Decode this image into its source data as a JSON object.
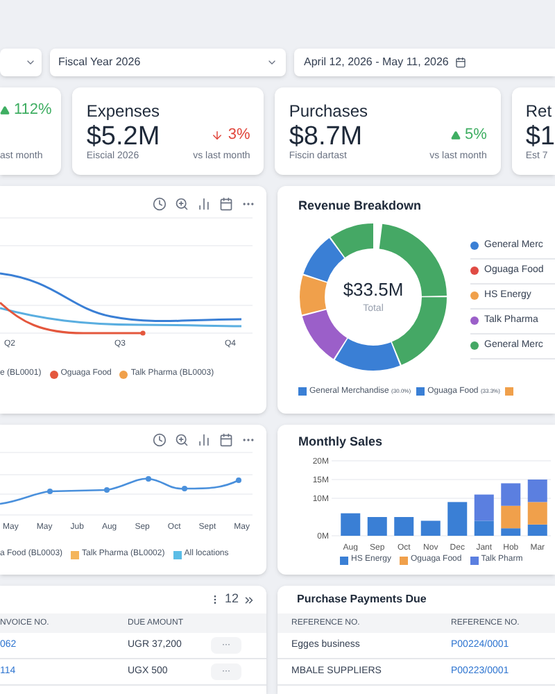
{
  "filters": {
    "fiscal_year": "Fiscal Year 2026",
    "date_range": "April 12, 2026 - May 11, 2026"
  },
  "kpis": [
    {
      "change": "112%",
      "rising": true,
      "note": "ast month"
    },
    {
      "title": "Expenses",
      "value": "$5.2M",
      "change": "3%",
      "rising": false,
      "subtitle": "Eiscial 2026",
      "note": "vs last month"
    },
    {
      "title": "Purchases",
      "value": "$8.7M",
      "change": "5%",
      "rising": true,
      "subtitle": "Fiscin dartast",
      "note": "vs last month"
    },
    {
      "title": "Ret",
      "value": "$1",
      "subtitle": "Est 7"
    }
  ],
  "revenue_by_location": {
    "x_labels": [
      "Q2",
      "Q3",
      "Q4"
    ],
    "legend": [
      {
        "label": "e (BL0001)"
      },
      {
        "label": "Oguaga Food",
        "color": "#e4573d"
      },
      {
        "label": "Talk Pharma (BL0003)",
        "color": "#f0a04b"
      }
    ]
  },
  "revenue_breakdown": {
    "title": "Revenue Breakdown",
    "total": "$33.5M",
    "total_label": "Total",
    "legend": [
      {
        "label": "General Merc",
        "color": "#3a7fd5"
      },
      {
        "label": "Oguaga Food",
        "color": "#e04b44"
      },
      {
        "label": "HS Energy",
        "color": "#f0a04b"
      },
      {
        "label": "Talk Pharma",
        "color": "#9b5fc9"
      },
      {
        "label": "General Merc",
        "color": "#45a865"
      }
    ],
    "bottom_legend": [
      {
        "label": "General Merchandise",
        "share": "(30.0%)",
        "color": "#3a7fd5"
      },
      {
        "label": "Oguaga Food",
        "share": "(33.3%)",
        "color": "#3a7fd5"
      },
      {
        "color": "#f0a04b"
      }
    ]
  },
  "trend_chart": {
    "x_labels": [
      "May",
      "May",
      "Jub",
      "Aug",
      "Sep",
      "Oct",
      "Sept",
      "May"
    ],
    "legend": [
      {
        "label": "a Food (BL0003)"
      },
      {
        "label": "Talk Pharma (BL0002)",
        "color": "#f4b55b"
      },
      {
        "label": "All locations",
        "color": "#5bbde6"
      }
    ]
  },
  "monthly_sales": {
    "title": "Monthly Sales",
    "chart_data": {
      "type": "bar",
      "stacked": true,
      "categories": [
        "Aug",
        "Sep",
        "Oct",
        "Nov",
        "Dec",
        "Jant",
        "Hob",
        "Mar"
      ],
      "yticks": [
        {
          "value": 0,
          "label": "0M"
        },
        {
          "value": 10,
          "label": "10M"
        },
        {
          "value": 15,
          "label": "15M"
        },
        {
          "value": 20,
          "label": "20M"
        }
      ],
      "ylim": [
        0,
        20
      ],
      "series": [
        {
          "name": "HS Energy",
          "color": "#3a7fd5",
          "values": [
            6,
            5,
            5,
            4,
            9,
            4,
            2,
            3
          ]
        },
        {
          "name": "Oguaga Food",
          "color": "#f0a04b",
          "values": [
            0,
            0,
            0,
            0,
            0,
            0,
            6,
            6
          ]
        },
        {
          "name": "Talk Pharm",
          "color": "#5b7fe0",
          "values": [
            0,
            0,
            0,
            0,
            0,
            7,
            6,
            6
          ]
        }
      ]
    }
  },
  "invoices": {
    "pagination": "12",
    "columns": [
      "NVOICE NO.",
      "DUE AMOUNT"
    ],
    "rows": [
      {
        "invoice": "062",
        "amount": "UGR 37,200",
        "action": "···"
      },
      {
        "invoice": "114",
        "amount": "UGX 500",
        "action": "···"
      }
    ]
  },
  "payments": {
    "title": "Purchase Payments Due",
    "columns": [
      "REFERENCE NO.",
      "REFERENCE NO."
    ],
    "rows": [
      {
        "name": "Egges business",
        "reference": "P00224/0001"
      },
      {
        "name": "MBALE SUPPLIERS",
        "reference": "P00223/0001"
      }
    ]
  }
}
